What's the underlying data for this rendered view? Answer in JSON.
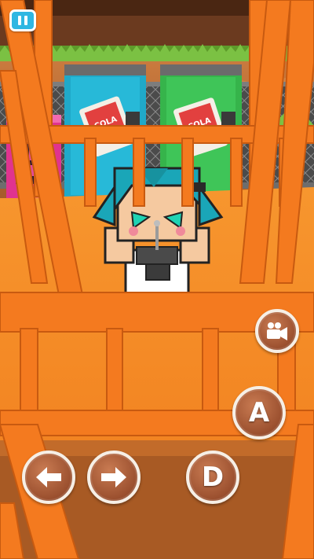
{
  "hud": {
    "pause_icon": "pause-icon",
    "buttons": {
      "left_arrow_icon": "arrow-left-icon",
      "right_arrow_icon": "arrow-right-icon",
      "d_label": "D",
      "a_label": "A",
      "camera_icon": "video-camera-icon"
    }
  },
  "machines": {
    "pink": {
      "color": "#e0338f"
    },
    "teal": {
      "color": "#20a9c9"
    },
    "green": {
      "color": "#36b44b"
    }
  },
  "palette": {
    "cage_orange": "#f47a1f",
    "floor_orange": "#f58a24",
    "hud_button": "#9a4f2e",
    "pause_button": "#2fb7e2",
    "character_hair": "#1aa6b8"
  }
}
